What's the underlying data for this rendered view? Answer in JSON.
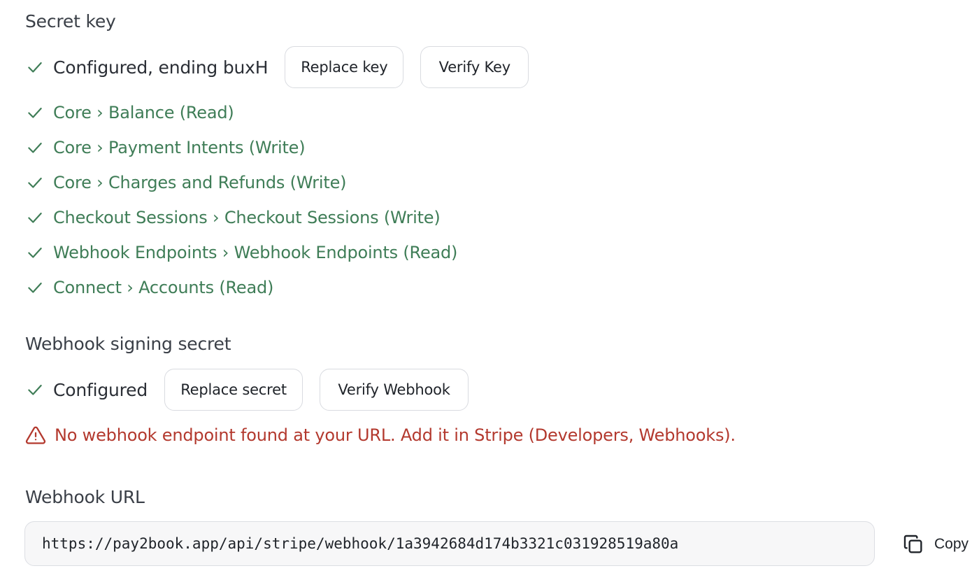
{
  "secret_key": {
    "title": "Secret key",
    "status": "Configured, ending buxH",
    "replace_label": "Replace key",
    "verify_label": "Verify Key",
    "permissions": [
      "Core › Balance (Read)",
      "Core › Payment Intents (Write)",
      "Core › Charges and Refunds (Write)",
      "Checkout Sessions › Checkout Sessions (Write)",
      "Webhook Endpoints › Webhook Endpoints (Read)",
      "Connect › Accounts (Read)"
    ]
  },
  "webhook_secret": {
    "title": "Webhook signing secret",
    "status": "Configured",
    "replace_label": "Replace secret",
    "verify_label": "Verify Webhook",
    "warning": "No webhook endpoint found at your URL. Add it in Stripe (Developers, Webhooks)."
  },
  "webhook_url": {
    "title": "Webhook URL",
    "value": "https://pay2book.app/api/stripe/webhook/1a3942684d174b3321c031928519a80a",
    "copy_label": "Copy"
  },
  "colors": {
    "success": "#3f7d57",
    "warning": "#b3392e",
    "border": "#d9dbe0"
  },
  "icons": {
    "check": "check-icon",
    "warning": "warning-triangle-icon",
    "copy": "copy-icon"
  }
}
